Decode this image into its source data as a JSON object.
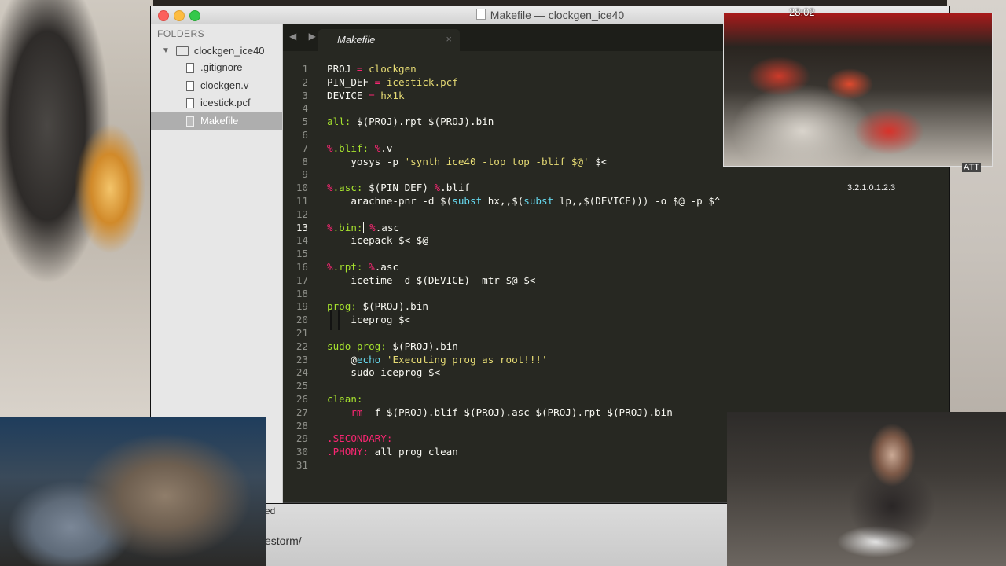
{
  "window": {
    "title": "Makefile — clockgen_ice40"
  },
  "sidebar": {
    "header": "FOLDERS",
    "root": "clockgen_ice40",
    "files": [
      ".gitignore",
      "clockgen.v",
      "icestick.pcf",
      "Makefile"
    ],
    "selected_index": 3
  },
  "tab": {
    "label": "Makefile",
    "close": "×",
    "nav": "◀ ▶"
  },
  "editor": {
    "current_line": 13,
    "lines": [
      [
        [
          "n",
          "PROJ "
        ],
        [
          "k",
          "="
        ],
        [
          "s",
          " clockgen"
        ]
      ],
      [
        [
          "n",
          "PIN_DEF "
        ],
        [
          "k",
          "="
        ],
        [
          "s",
          " icestick.pcf"
        ]
      ],
      [
        [
          "n",
          "DEVICE "
        ],
        [
          "k",
          "="
        ],
        [
          "s",
          " hx1k"
        ]
      ],
      [],
      [
        [
          "v",
          "all:"
        ],
        [
          "n",
          " $(PROJ).rpt $(PROJ).bin"
        ]
      ],
      [],
      [
        [
          "k",
          "%"
        ],
        [
          "v",
          ".blif:"
        ],
        [
          "n",
          " "
        ],
        [
          "k",
          "%"
        ],
        [
          "n",
          ".v"
        ]
      ],
      [
        [
          "n",
          "    yosys -p "
        ],
        [
          "s",
          "'synth_ice40 -top top -blif $@'"
        ],
        [
          "n",
          " $<"
        ]
      ],
      [],
      [
        [
          "k",
          "%"
        ],
        [
          "v",
          ".asc:"
        ],
        [
          "n",
          " $(PIN_DEF) "
        ],
        [
          "k",
          "%"
        ],
        [
          "n",
          ".blif"
        ]
      ],
      [
        [
          "n",
          "    arachne-pnr -d $("
        ],
        [
          "f",
          "subst"
        ],
        [
          "n",
          " hx,,$("
        ],
        [
          "f",
          "subst"
        ],
        [
          "n",
          " lp,,$(DEVICE))) -o $@ -p $^"
        ]
      ],
      [],
      [
        [
          "k",
          "%"
        ],
        [
          "v",
          ".bin:"
        ],
        [
          "c",
          ""
        ],
        [
          "n",
          " "
        ],
        [
          "k",
          "%"
        ],
        [
          "n",
          ".asc"
        ]
      ],
      [
        [
          "n",
          "    icepack $< $@"
        ]
      ],
      [],
      [
        [
          "k",
          "%"
        ],
        [
          "v",
          ".rpt:"
        ],
        [
          "n",
          " "
        ],
        [
          "k",
          "%"
        ],
        [
          "n",
          ".asc"
        ]
      ],
      [
        [
          "n",
          "    icetime -d $(DEVICE) -mtr $@ $<"
        ]
      ],
      [],
      [
        [
          "v",
          "prog:"
        ],
        [
          "n",
          " $(PROJ).bin"
        ]
      ],
      [
        [
          "n",
          "    iceprog $<"
        ]
      ],
      [],
      [
        [
          "v",
          "sudo-prog:"
        ],
        [
          "n",
          " $(PROJ).bin"
        ]
      ],
      [
        [
          "n",
          "    @"
        ],
        [
          "f",
          "echo"
        ],
        [
          "n",
          " "
        ],
        [
          "s",
          "'Executing prog as root!!!'"
        ]
      ],
      [
        [
          "n",
          "    sudo iceprog $<"
        ]
      ],
      [],
      [
        [
          "v",
          "clean:"
        ]
      ],
      [
        [
          "n",
          "    "
        ],
        [
          "k",
          "rm"
        ],
        [
          "n",
          " -f $(PROJ).blif $(PROJ).asc $(PROJ).rpt $(PROJ).bin"
        ]
      ],
      [],
      [
        [
          "k",
          ".SECONDARY:"
        ]
      ],
      [
        [
          "k",
          ".PHONY:"
        ],
        [
          "n",
          " all prog clean"
        ]
      ],
      []
    ]
  },
  "overlays": {
    "timer": "28:02",
    "att_label": "ATT",
    "sequence": "3.2.1.0.1.2.3",
    "bottom_partial_text": "estorm/",
    "status_partial": "ed"
  },
  "colors": {
    "editor_bg": "#272822",
    "keyword": "#f92672",
    "string": "#e6db74",
    "target": "#a6e22e",
    "function": "#66d9ef",
    "text": "#f8f8f2"
  }
}
